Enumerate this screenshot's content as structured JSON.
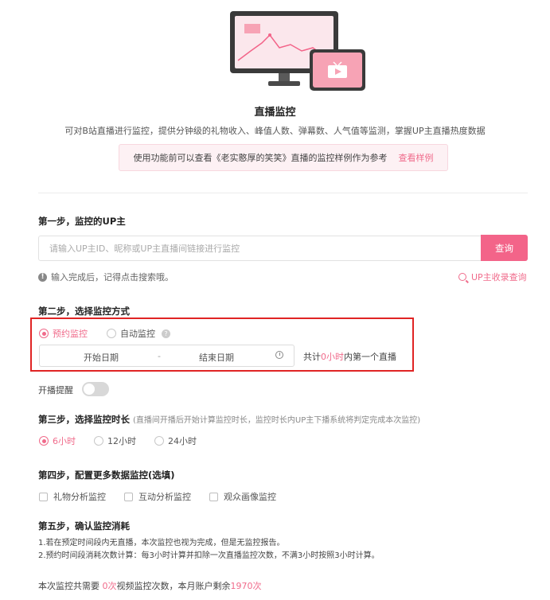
{
  "header": {
    "title": "直播监控",
    "subtitle": "可对B站直播进行监控，提供分钟级的礼物收入、峰值人数、弹幕数、人气值等监测，掌握UP主直播热度数据",
    "notice_text": "使用功能前可以查看《老实憨厚的笑笑》直播的监控样例作为参考",
    "notice_link": "查看样例"
  },
  "step1": {
    "title": "第一步，监控的UP主",
    "search_placeholder": "请输入UP主ID、昵称或UP主直播间链接进行监控",
    "search_value": "",
    "search_button": "查询",
    "hint_icon_text": "!",
    "hint": "输入完成后，记得点击搜索哦。",
    "collect_link": "UP主收录查询"
  },
  "step2": {
    "title": "第二步，选择监控方式",
    "options": [
      {
        "label": "预约监控",
        "selected": true
      },
      {
        "label": "自动监控",
        "selected": false
      }
    ],
    "help_icon_text": "?",
    "start_placeholder": "开始日期",
    "separator": "-",
    "end_placeholder": "结束日期",
    "total_prefix": "共计",
    "total_hours": "0小时",
    "total_suffix": "内第一个直播",
    "reminder_label": "开播提醒",
    "reminder_on": false
  },
  "step3": {
    "title": "第三步，选择监控时长",
    "note": "(直播间开播后开始计算监控时长，监控时长内UP主下播系统将判定完成本次监控)",
    "options": [
      {
        "label": "6小时",
        "selected": true
      },
      {
        "label": "12小时",
        "selected": false
      },
      {
        "label": "24小时",
        "selected": false
      }
    ]
  },
  "step4": {
    "title": "第四步，配置更多数据监控(选填)",
    "options": [
      {
        "label": "礼物分析监控",
        "checked": false
      },
      {
        "label": "互动分析监控",
        "checked": false
      },
      {
        "label": "观众画像监控",
        "checked": false
      }
    ]
  },
  "step5": {
    "title": "第五步，确认监控消耗",
    "rule1": "1.若在预定时间段内无直播，本次监控也视为完成，但是无监控报告。",
    "rule2": "2.预约时间段消耗次数计算：每3小时计算并扣除一次直播监控次数，不满3小时按照3小时计算。",
    "summary_prefix": "本次监控共需要",
    "summary_need": "0次",
    "summary_middle": "视频监控次数，本月账户剩余",
    "summary_left": "1970次"
  },
  "colors": {
    "accent": "#f36489",
    "highlight_box": "#e02424"
  }
}
